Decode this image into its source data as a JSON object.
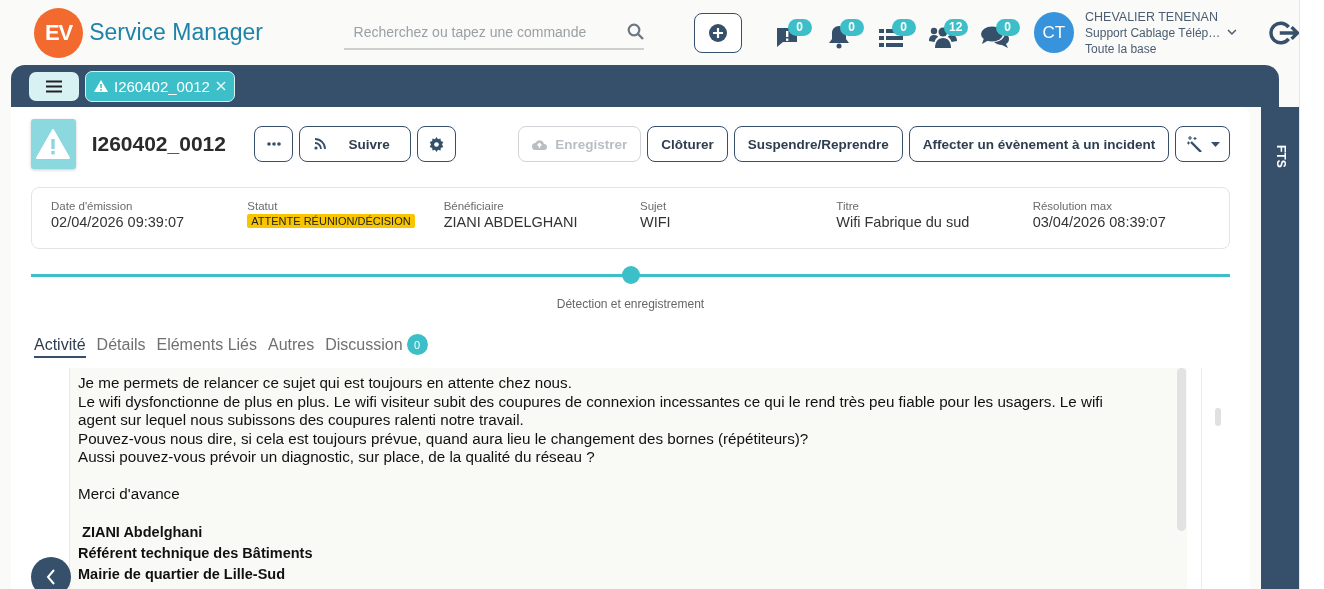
{
  "header": {
    "logo_text": "EV",
    "app_name": "Service Manager",
    "search": {
      "placeholder": "Recherchez ou tapez une commande"
    },
    "counters": [
      {
        "kind": "alert",
        "count": "0"
      },
      {
        "kind": "bell",
        "count": "0"
      },
      {
        "kind": "list",
        "count": "0"
      },
      {
        "kind": "group",
        "count": "12"
      },
      {
        "kind": "chat",
        "count": "0"
      }
    ],
    "user": {
      "initials": "CT",
      "name": "CHEVALIER TENENAN",
      "role": "Support Cablage Télép…",
      "scope": "Toute la base"
    }
  },
  "open_tabs": [
    {
      "label": "I260402_0012",
      "selected": true
    }
  ],
  "incident": {
    "id": "I260402_0012",
    "actions": [
      {
        "kind": "more",
        "disabled": false
      },
      {
        "kind": "follow",
        "label": "Suivre",
        "disabled": false
      },
      {
        "kind": "settings",
        "disabled": false
      },
      {
        "kind": "save",
        "label": "Enregistrer",
        "disabled": true
      },
      {
        "kind": "text",
        "label": "Clôturer",
        "disabled": false
      },
      {
        "kind": "text",
        "label": "Suspendre/Reprendre",
        "disabled": false
      },
      {
        "kind": "text",
        "label": "Affecter un évènement à un incident",
        "disabled": false
      },
      {
        "kind": "wand",
        "disabled": false
      }
    ],
    "fields": [
      {
        "kind": "text",
        "label": "Date d'émission",
        "value": "02/04/2026 09:39:07"
      },
      {
        "kind": "badge",
        "label": "Statut",
        "value": "ATTENTE RÉUNION/DÉCISION"
      },
      {
        "kind": "text",
        "label": "Bénéficiaire",
        "value": "ZIANI ABDELGHANI"
      },
      {
        "kind": "text",
        "label": "Sujet",
        "value": "WIFI"
      },
      {
        "kind": "text",
        "label": "Titre",
        "value": "Wifi Fabrique du sud"
      },
      {
        "kind": "text",
        "label": "Résolution max",
        "value": "03/04/2026 08:39:07"
      }
    ],
    "stage": {
      "label": "Détection et enregistrement"
    },
    "tabs": [
      {
        "label": "Activité",
        "selected": true
      },
      {
        "label": "Détails",
        "selected": false
      },
      {
        "label": "Eléments Liés",
        "selected": false
      },
      {
        "label": "Autres",
        "selected": false
      },
      {
        "label": "Discussion",
        "selected": false,
        "count": "0"
      }
    ],
    "message": {
      "paragraphs": [
        {
          "bold": false,
          "lines": [
            "Je me permets de relancer ce sujet qui est toujours en attente chez nous.",
            "Le wifi dysfonctionne de plus en plus. Le wifi visiteur subit des coupures de connexion incessantes ce qui le rend très peu fiable pour les usagers. Le wifi agent sur lequel nous subissons des coupures ralenti notre travail.",
            "Pouvez-vous nous dire, si cela est toujours prévue, quand aura lieu le changement des bornes (répétiteurs)?",
            "Aussi pouvez-vous prévoir un diagnostic, sur place,  de la qualité du réseau ?"
          ]
        },
        {
          "bold": false,
          "lines": [
            "Merci d'avance"
          ]
        },
        {
          "bold": true,
          "lines": [
            " ZIANI Abdelghani",
            "Référent technique des Bâtiments",
            "Mairie de quartier de Lille-Sud"
          ]
        }
      ]
    }
  },
  "side_panel": {
    "label": "FTS"
  }
}
